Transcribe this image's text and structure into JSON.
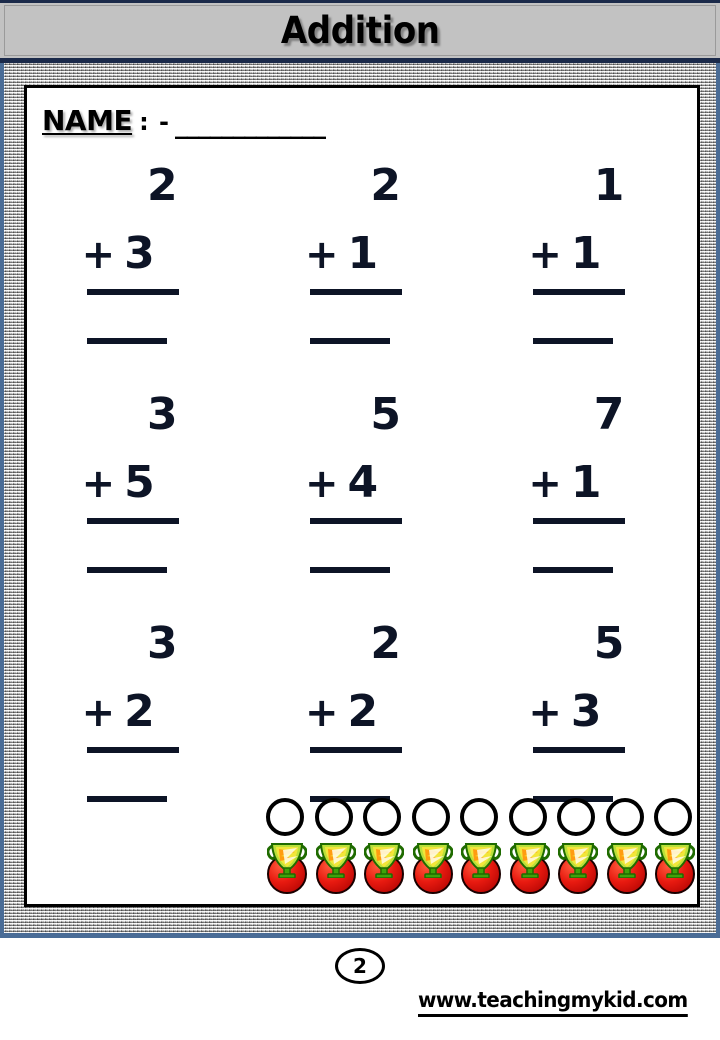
{
  "header": {
    "title": "Addition"
  },
  "name_field": {
    "label": "NAME",
    "separator": ": -",
    "blank": "_____________"
  },
  "worksheet": {
    "operator": "+",
    "rows": [
      [
        {
          "top": "2",
          "bottom": "3"
        },
        {
          "top": "2",
          "bottom": "1"
        },
        {
          "top": "1",
          "bottom": "1"
        }
      ],
      [
        {
          "top": "3",
          "bottom": "5"
        },
        {
          "top": "5",
          "bottom": "4"
        },
        {
          "top": "7",
          "bottom": "1"
        }
      ],
      [
        {
          "top": "3",
          "bottom": "2"
        },
        {
          "top": "2",
          "bottom": "2"
        },
        {
          "top": "5",
          "bottom": "3"
        }
      ]
    ]
  },
  "decoration": {
    "icon_name": "apple-counter-icon",
    "count": 9,
    "circle_color": "#ffffff",
    "apple_color": "#e81a10",
    "leaf_color": "#8dc63f"
  },
  "footer": {
    "page_number": "2",
    "website": "www.teachingmykid.com"
  },
  "colors": {
    "title_bar_bg": "#c2c2c2",
    "title_border": "#1b2a4a",
    "frame_edge": "#4a6c96",
    "ink": "#0d1426"
  }
}
